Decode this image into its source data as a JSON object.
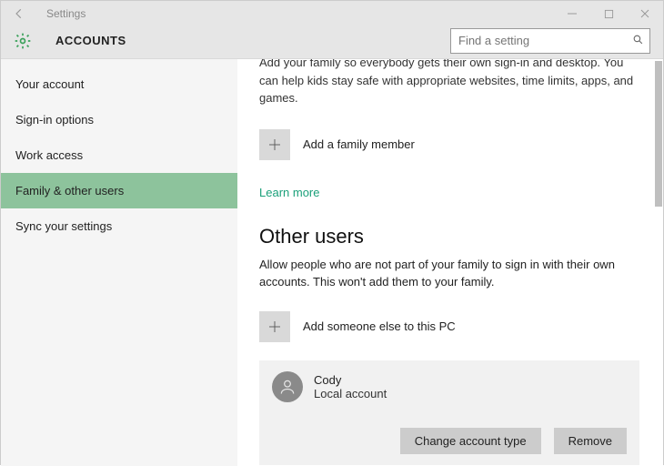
{
  "window": {
    "title": "Settings"
  },
  "header": {
    "title": "ACCOUNTS",
    "search_placeholder": "Find a setting"
  },
  "sidebar": {
    "items": [
      {
        "label": "Your account"
      },
      {
        "label": "Sign-in options"
      },
      {
        "label": "Work access"
      },
      {
        "label": "Family & other users"
      },
      {
        "label": "Sync your settings"
      }
    ],
    "active_index": 3
  },
  "family": {
    "truncated_intro": "Add your family so everybody gets their own sign-in and desktop. You can help kids stay safe with appropriate websites, time limits, apps, and games.",
    "add_label": "Add a family member",
    "learn_more": "Learn more"
  },
  "other_users": {
    "title": "Other users",
    "desc": "Allow people who are not part of your family to sign in with their own accounts. This won't add them to your family.",
    "add_label": "Add someone else to this PC",
    "user": {
      "name": "Cody",
      "subtitle": "Local account"
    },
    "buttons": {
      "change_type": "Change account type",
      "remove": "Remove"
    }
  }
}
